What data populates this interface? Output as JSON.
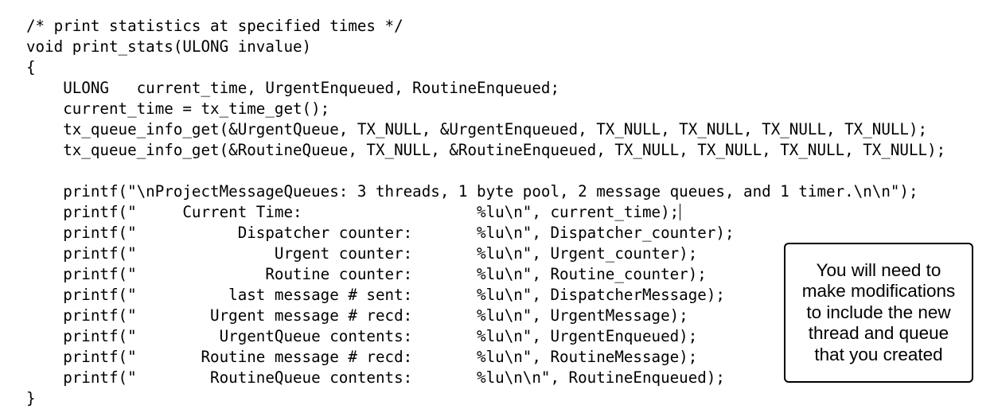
{
  "code": {
    "lines": [
      "/* print statistics at specified times */",
      "void print_stats(ULONG invalue)",
      "{",
      "    ULONG   current_time, UrgentEnqueued, RoutineEnqueued;",
      "    current_time = tx_time_get();",
      "    tx_queue_info_get(&UrgentQueue, TX_NULL, &UrgentEnqueued, TX_NULL, TX_NULL, TX_NULL, TX_NULL);",
      "    tx_queue_info_get(&RoutineQueue, TX_NULL, &RoutineEnqueued, TX_NULL, TX_NULL, TX_NULL, TX_NULL);",
      "",
      "    printf(\"\\nProjectMessageQueues: 3 threads, 1 byte pool, 2 message queues, and 1 timer.\\n\\n\");",
      "    printf(\"     Current Time:                   %lu\\n\", current_time);",
      "    printf(\"           Dispatcher counter:       %lu\\n\", Dispatcher_counter);",
      "    printf(\"               Urgent counter:       %lu\\n\", Urgent_counter);",
      "    printf(\"              Routine counter:       %lu\\n\", Routine_counter);",
      "    printf(\"          last message # sent:       %lu\\n\", DispatcherMessage);",
      "    printf(\"        Urgent message # recd:       %lu\\n\", UrgentMessage);",
      "    printf(\"         UrgentQueue contents:       %lu\\n\", UrgentEnqueued);",
      "    printf(\"       Routine message # recd:       %lu\\n\", RoutineMessage);",
      "    printf(\"        RoutineQueue contents:       %lu\\n\\n\", RoutineEnqueued);",
      "}"
    ]
  },
  "note": {
    "lines": [
      "You will need to",
      "make modifications",
      "to include the new",
      "thread and queue",
      "that you created"
    ]
  }
}
